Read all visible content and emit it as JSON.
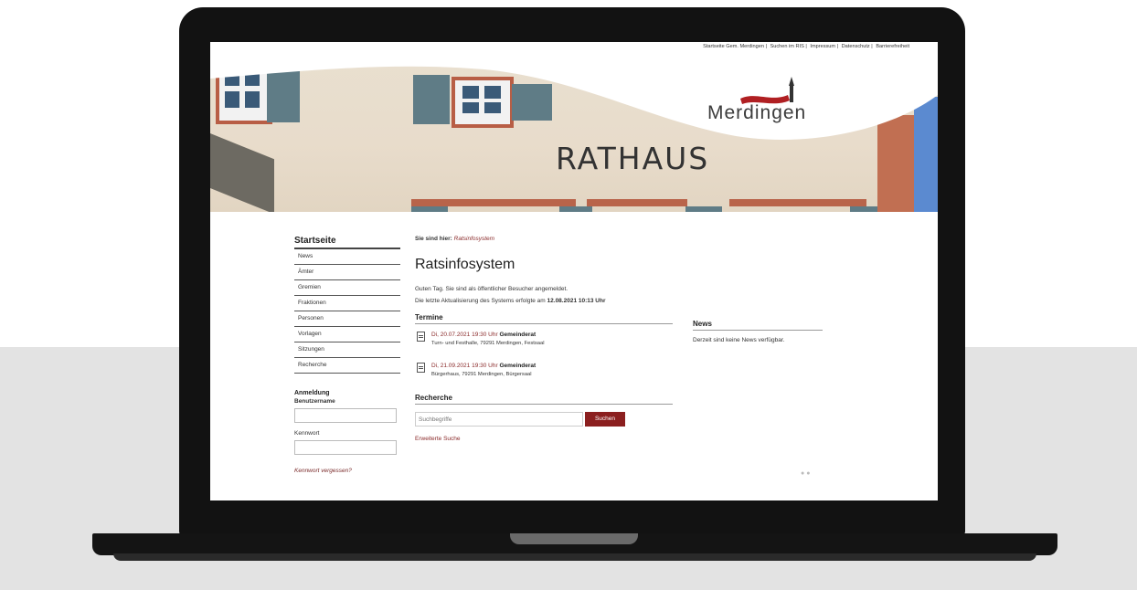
{
  "header": {
    "top_links": [
      "Startseite Gem. Merdingen |",
      "Suchen im RIS |",
      "Impressum |",
      "Datenschutz |",
      "Barrierefreiheit"
    ],
    "banner_title": "RATHAUS",
    "logo_text": "Merdingen"
  },
  "sidebar": {
    "title": "Startseite",
    "items": [
      "News",
      "Ämter",
      "Gremien",
      "Fraktionen",
      "Personen",
      "Vorlagen",
      "Sitzungen",
      "Recherche"
    ],
    "login_title": "Anmeldung",
    "username_label": "Benutzername",
    "password_label": "Kennwort",
    "forgot_link": "Kennwort vergessen?"
  },
  "main": {
    "breadcrumb_prefix": "Sie sind hier:",
    "breadcrumb_link": "Ratsinfosystem",
    "title": "Ratsinfosystem",
    "greeting": "Guten Tag. Sie sind als öffentlicher Besucher angemeldet.",
    "update_prefix": "Die letzte Aktualisierung des Systems erfolgte am",
    "update_value": "12.08.2021 10:13 Uhr",
    "termine_title": "Termine",
    "termine": [
      {
        "date": "Di, 20.07.2021 19:30 Uhr",
        "gremium": "Gemeinderat",
        "location": "Turn- und Festhalle, 79291 Merdingen, Festsaal"
      },
      {
        "date": "Di, 21.09.2021 19:30 Uhr",
        "gremium": "Gemeinderat",
        "location": "Bürgerhaus, 79291 Merdingen, Bürgersaal"
      }
    ],
    "recherche_title": "Recherche",
    "search_placeholder": "Suchbegriffe",
    "search_button": "Suchen",
    "advanced_search": "Erweiterte Suche"
  },
  "news": {
    "title": "News",
    "empty_text": "Derzeit sind keine News verfügbar."
  },
  "colors": {
    "accent": "#8b1f1f",
    "laptop": "#121212"
  }
}
